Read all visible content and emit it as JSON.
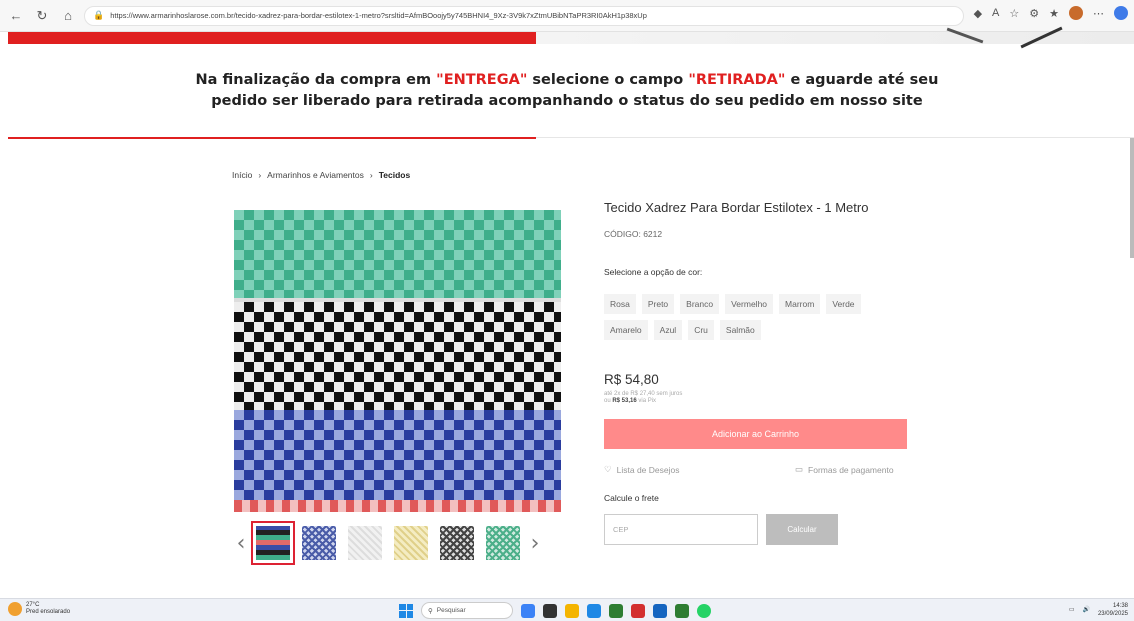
{
  "browser": {
    "url": "https://www.armarinhoslarose.com.br/tecido-xadrez-para-bordar-estilotex-1-metro?srsltid=AfmBOoojy5y745BHNI4_9Xz-3V9k7xZtmUBibNTaPR3RI0AkH1p38xUp"
  },
  "notice": {
    "line1_a": "Na finalização da compra em ",
    "entrega": "\"ENTREGA\"",
    "line1_b": " selecione o campo ",
    "retirada": "\"RETIRADA\"",
    "line1_c": " e aguarde até seu",
    "line2": "pedido ser liberado para retirada acompanhando o status do seu pedido em nosso site"
  },
  "breadcrumb": {
    "home": "Início",
    "category": "Armarinhos e Aviamentos",
    "current": "Tecidos",
    "sep": "›"
  },
  "product": {
    "title": "Tecido Xadrez Para Bordar Estilotex - 1 Metro",
    "code": "CÓDIGO: 6212",
    "select_label": "Selecione a opção de cor:",
    "colors": [
      "Rosa",
      "Preto",
      "Branco",
      "Vermelho",
      "Marrom",
      "Verde",
      "Amarelo",
      "Azul",
      "Cru",
      "Salmão"
    ],
    "price": "R$ 54,80",
    "installments": "até 2x de R$ 27,40 sem juros",
    "pix_prefix": "ou ",
    "pix_value": "R$ 53,16",
    "pix_suffix": " via Pix",
    "add_to_cart": "Adicionar ao Carrinho",
    "wishlist": "Lista de Desejos",
    "payment": "Formas de pagamento",
    "shipping_label": "Calcule o frete",
    "cep_placeholder": "CEP",
    "calc_button": "Calcular"
  },
  "taskbar": {
    "temp": "27°C",
    "weather": "Pred ensolarado",
    "search": "Pesquisar",
    "time": "14:38",
    "date": "23/09/2025"
  },
  "colors": {
    "accent": "#e02020",
    "button": "#ff8a8a",
    "calc": "#bdbdbd"
  }
}
